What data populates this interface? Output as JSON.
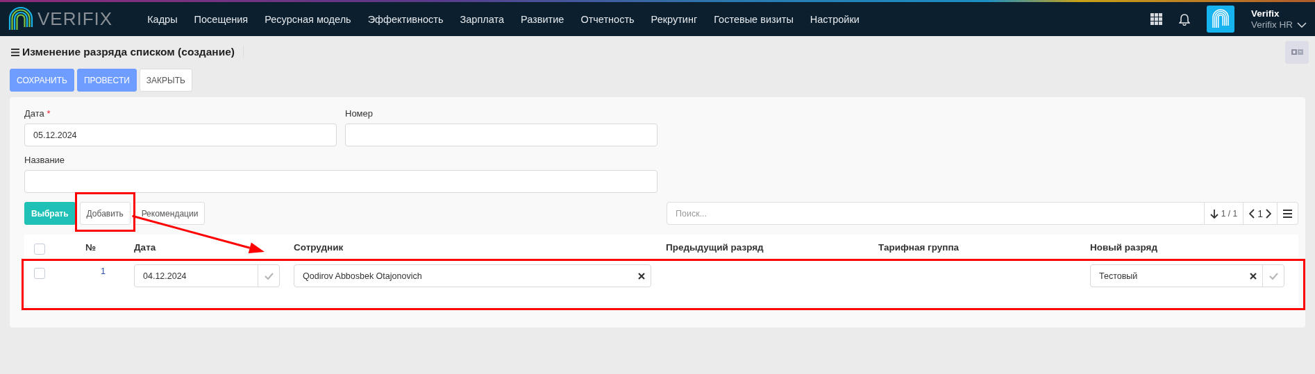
{
  "nav": {
    "logo": "VERIFIX",
    "menu": [
      {
        "label": "Кадры"
      },
      {
        "label": "Посещения"
      },
      {
        "label": "Ресурсная модель"
      },
      {
        "label": "Эффективность"
      },
      {
        "label": "Зарплата"
      },
      {
        "label": "Развитие"
      },
      {
        "label": "Отчетность"
      },
      {
        "label": "Рекрутинг"
      },
      {
        "label": "Гостевые визиты"
      },
      {
        "label": "Настройки"
      }
    ],
    "user": {
      "name": "Verifix",
      "org": "Verifix HR"
    }
  },
  "page": {
    "title": "Изменение разряда списком (создание)"
  },
  "actions": [
    {
      "label": "СОХРАНИТЬ",
      "kind": "primary"
    },
    {
      "label": "ПРОВЕСТИ",
      "kind": "primary"
    },
    {
      "label": "ЗАКРЫТЬ",
      "kind": "default"
    }
  ],
  "form": {
    "fields": [
      {
        "label": "Дата",
        "required_mark": "*",
        "value": "05.12.2024"
      },
      {
        "label": "Номер"
      },
      {
        "label": "Название"
      }
    ]
  },
  "table_toolbar": {
    "buttons": [
      {
        "label": "Выбрать",
        "kind": "accent",
        "highlighted": false
      },
      {
        "label": "Добавить",
        "kind": "default",
        "highlighted": true
      },
      {
        "label": "Рекомендации",
        "kind": "default",
        "highlighted": false
      }
    ],
    "search": {
      "placeholder": "Поиск..."
    },
    "count": "1 / 1",
    "page": "1"
  },
  "table": {
    "columns": [
      "№",
      "Дата",
      "Сотрудник",
      "Предыдущий разряд",
      "Тарифная группа",
      "Новый разряд"
    ],
    "all_checked": false,
    "rows": [
      {
        "checked": false,
        "highlighted": true,
        "number": "1",
        "date": "04.12.2024",
        "employee": "Qodirov Abbosbek Otajonovich",
        "new_grade": "Тестовый"
      }
    ]
  },
  "annotation_arrow": true
}
